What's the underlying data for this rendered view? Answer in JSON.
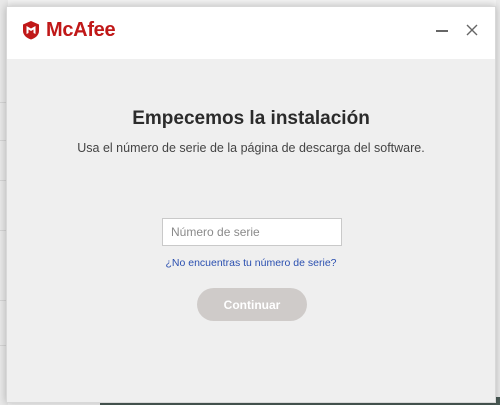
{
  "window": {
    "brand": "McAfee",
    "brand_color": "#c01818"
  },
  "controls": {
    "minimize_icon": "minimize-icon",
    "close_icon": "close-icon"
  },
  "main": {
    "heading": "Empecemos la instalación",
    "subtitle": "Usa el número de serie de la página de descarga del software.",
    "serial_placeholder": "Número de serie",
    "serial_value": "",
    "help_link": "¿No encuentras tu número de serie?",
    "continue_label": "Continuar",
    "link_color": "#2a4fb0",
    "button_color": "#cfcbc9"
  }
}
